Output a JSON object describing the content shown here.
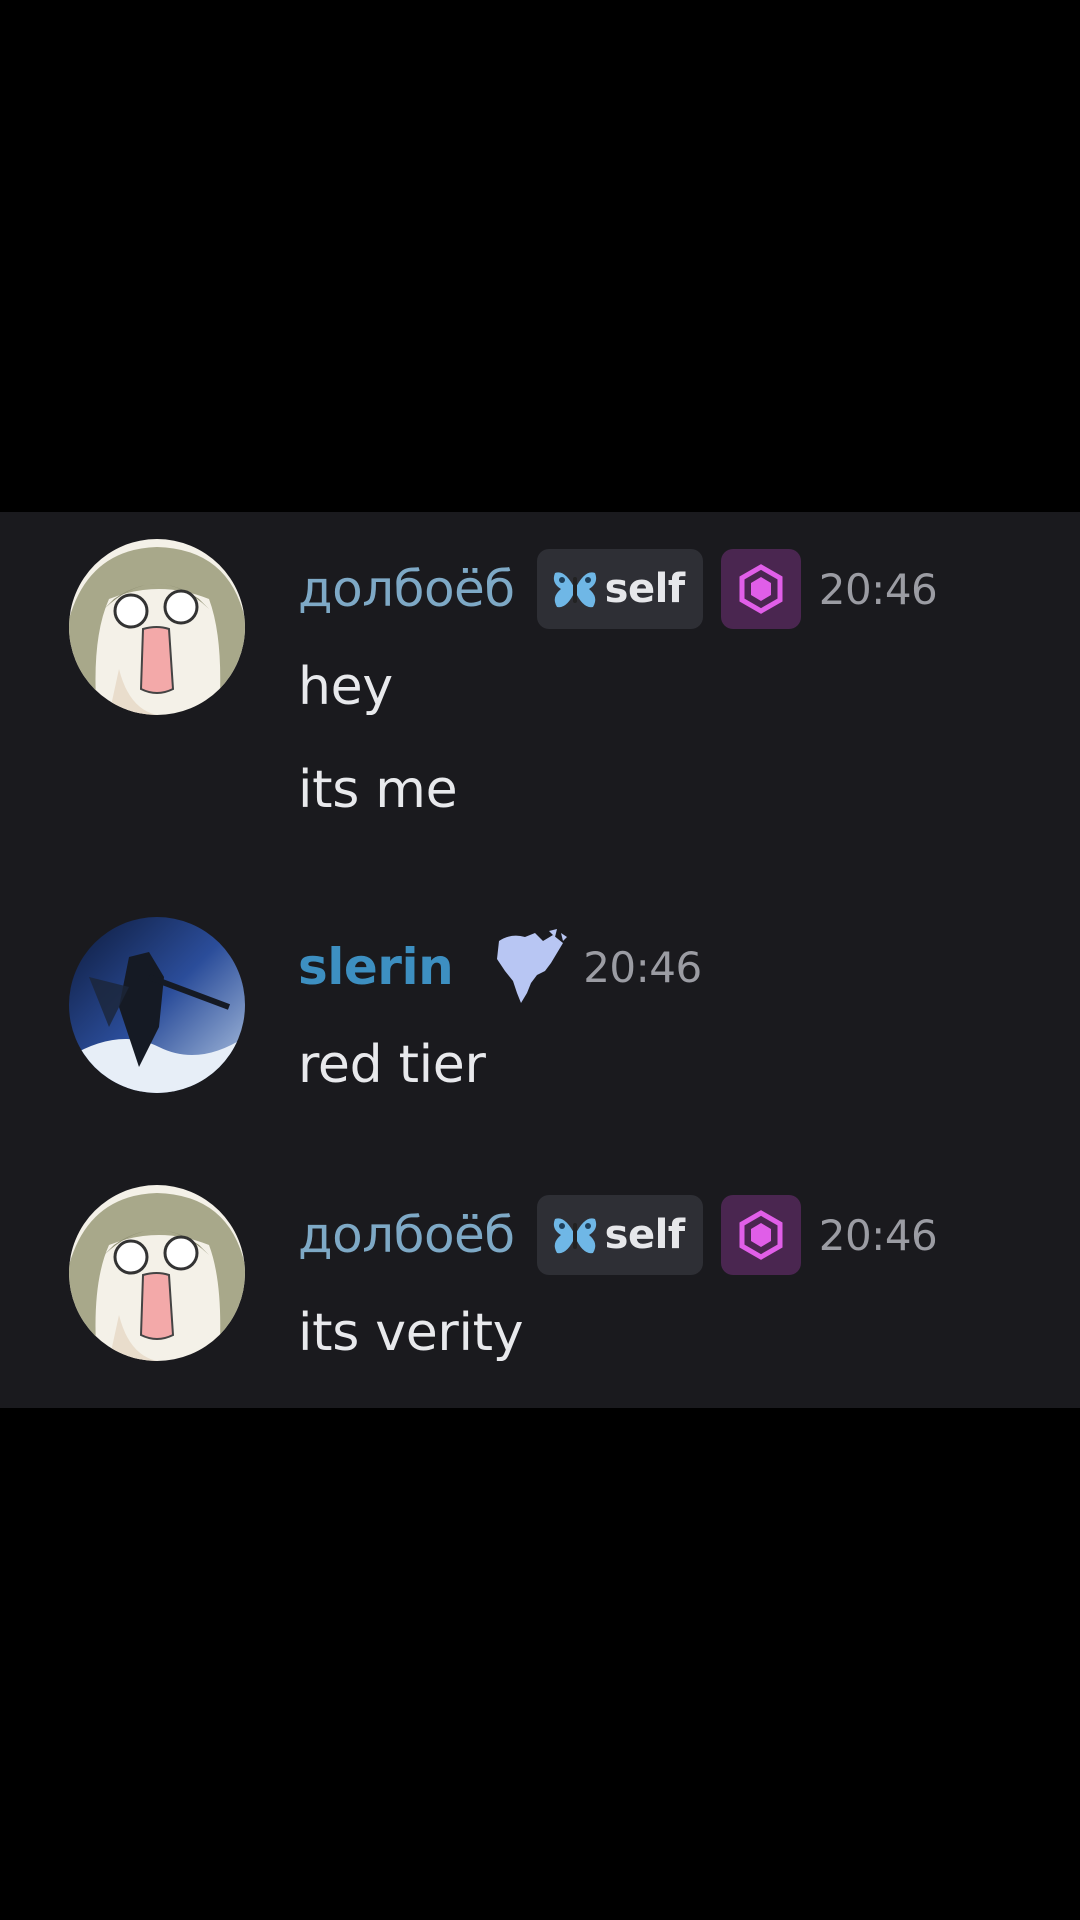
{
  "messages": [
    {
      "username": "долбоёб",
      "username_color": "#7ea9c6",
      "tag": "self",
      "tag_icon": "butterfly-icon",
      "role_icon": "hexagon-gem-icon",
      "role_color": "#e05ee8",
      "timestamp": "20:46",
      "lines": [
        "hey",
        "its me"
      ]
    },
    {
      "username": "slerin",
      "username_color": "#3d8fc1",
      "role_icon": "north-america-map-icon",
      "timestamp": "20:46",
      "lines": [
        "red tier"
      ]
    },
    {
      "username": "долбоёб",
      "username_color": "#7ea9c6",
      "tag": "self",
      "tag_icon": "butterfly-icon",
      "role_icon": "hexagon-gem-icon",
      "role_color": "#e05ee8",
      "timestamp": "20:46",
      "lines": [
        "its verity"
      ]
    }
  ]
}
